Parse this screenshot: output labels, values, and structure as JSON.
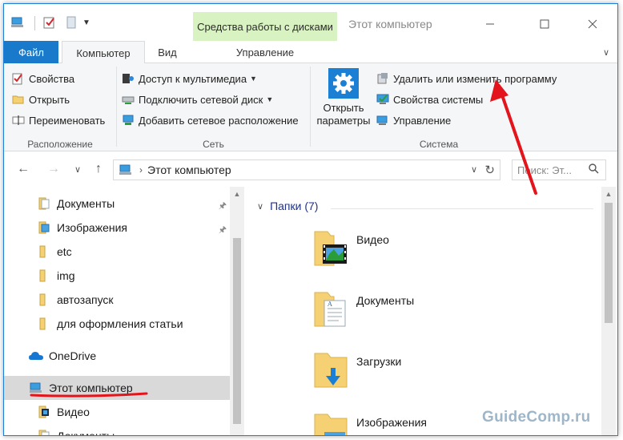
{
  "window": {
    "title": "Этот компьютер",
    "contextual_tab": "Средства работы с дисками",
    "controls": [
      "minimize",
      "maximize",
      "close"
    ]
  },
  "tabs": {
    "file": "Файл",
    "computer": "Компьютер",
    "view": "Вид",
    "manage": "Управление"
  },
  "ribbon": {
    "location": {
      "label": "Расположение",
      "properties": "Свойства",
      "open": "Открыть",
      "rename": "Переименовать"
    },
    "network": {
      "label": "Сеть",
      "media_access": "Доступ к мультимедиа",
      "map_drive": "Подключить сетевой диск",
      "add_location": "Добавить сетевое расположение"
    },
    "system": {
      "label": "Система",
      "open_settings_line1": "Открыть",
      "open_settings_line2": "параметры",
      "uninstall": "Удалить или изменить программу",
      "system_properties": "Свойства системы",
      "manage": "Управление"
    }
  },
  "address": {
    "path": "Этот компьютер",
    "search_placeholder": "Поиск: Эт..."
  },
  "nav": {
    "items": [
      {
        "label": "Документы",
        "pinned": true
      },
      {
        "label": "Изображения",
        "pinned": true
      },
      {
        "label": "etc",
        "pinned": false
      },
      {
        "label": "img",
        "pinned": false
      },
      {
        "label": "автозапуск",
        "pinned": false
      },
      {
        "label": "для оформления статьи",
        "pinned": false
      }
    ],
    "onedrive": "OneDrive",
    "this_pc": "Этот компьютер",
    "sub_items": [
      "Видео",
      "Документы"
    ]
  },
  "content": {
    "group_header": "Папки (7)",
    "folders": [
      "Видео",
      "Документы",
      "Загрузки",
      "Изображения"
    ]
  },
  "watermark": "GuideComp.ru",
  "colors": {
    "accent": "#1979ca",
    "context_tab_bg": "#d9f2c2",
    "annotation_red": "#e3141b",
    "folder_yellow": "#f5d174",
    "group_header": "#1e3287"
  }
}
